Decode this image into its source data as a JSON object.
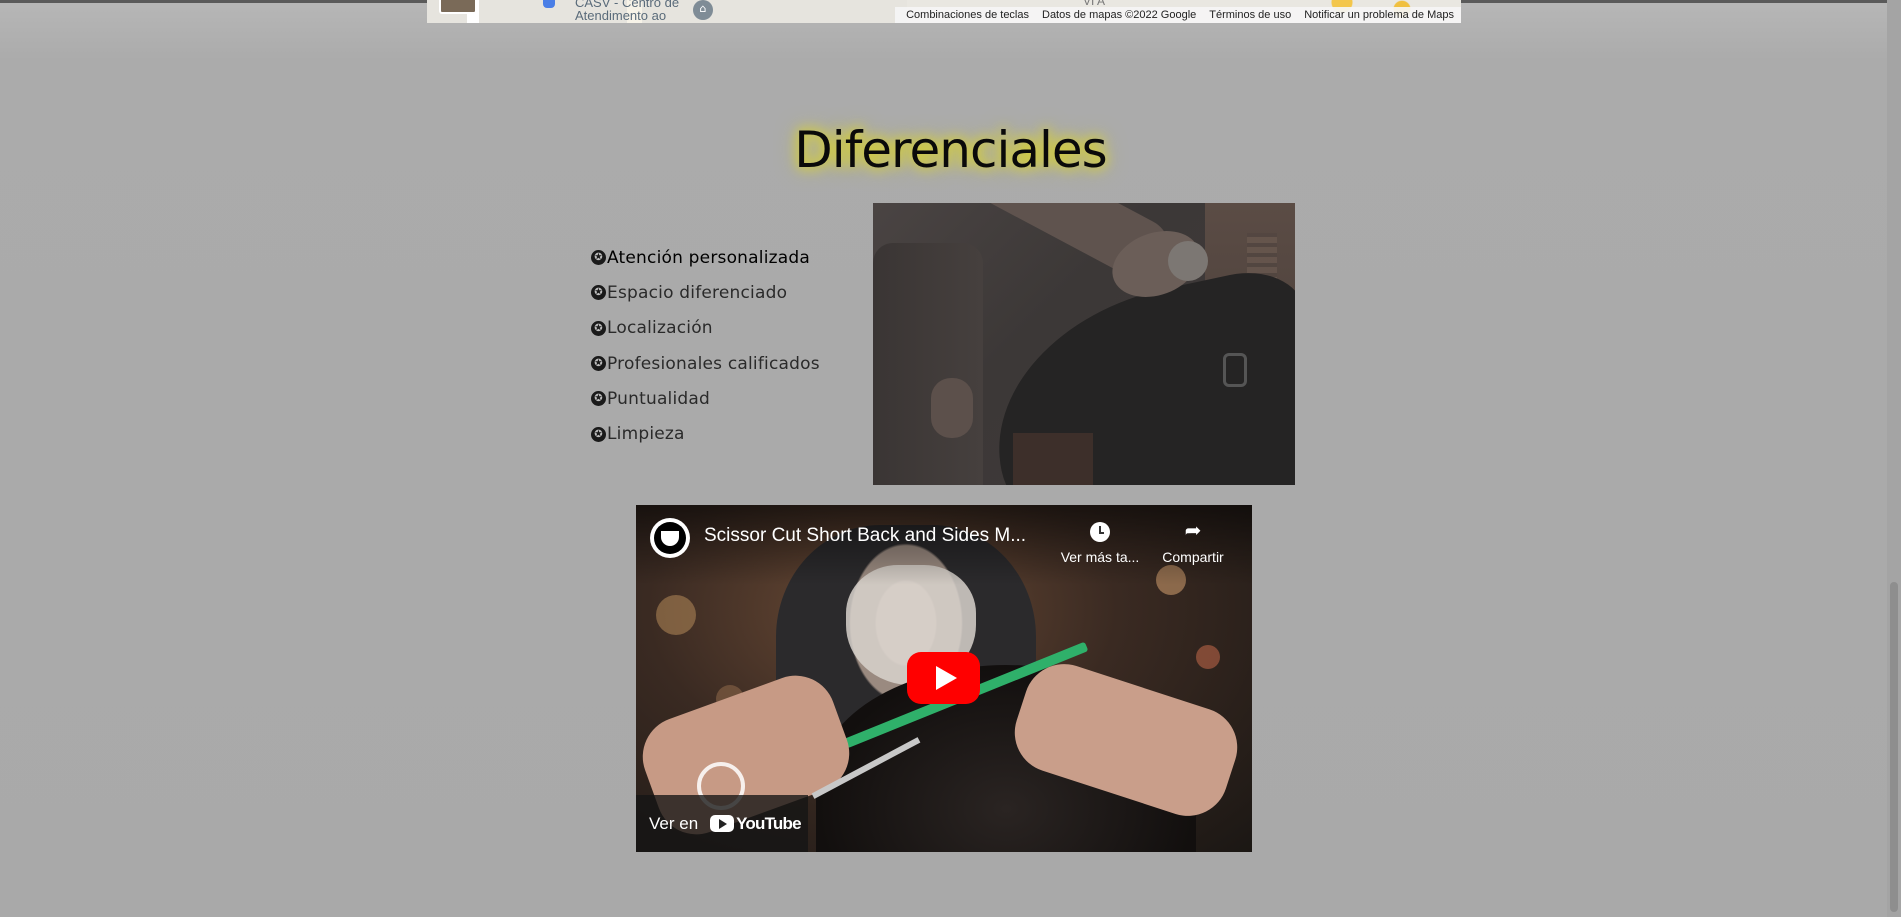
{
  "map": {
    "place_label": "CASV - Centro de Atendimento ao",
    "secondary_label": "VI A",
    "attribution": {
      "shortcuts": "Combinaciones de teclas",
      "data": "Datos de mapas ©2022 Google",
      "terms": "Términos de uso",
      "report": "Notificar un problema de Maps"
    }
  },
  "section": {
    "title": "Diferenciales",
    "bullet_glyph": "✪",
    "items": [
      "Atención personalizada",
      "Espacio diferenciado",
      "Localización",
      "Profesionales calificados",
      "Puntualidad",
      "Limpieza"
    ]
  },
  "video": {
    "title": "Scissor Cut Short Back and Sides M...",
    "watch_later_label": "Ver más ta...",
    "share_label": "Compartir",
    "watch_on_label": "Ver en",
    "platform_label": "YouTube",
    "brand_color": "#ff0000"
  },
  "colors": {
    "background": "#a9a9a9",
    "title_glow": "#e8e000"
  }
}
